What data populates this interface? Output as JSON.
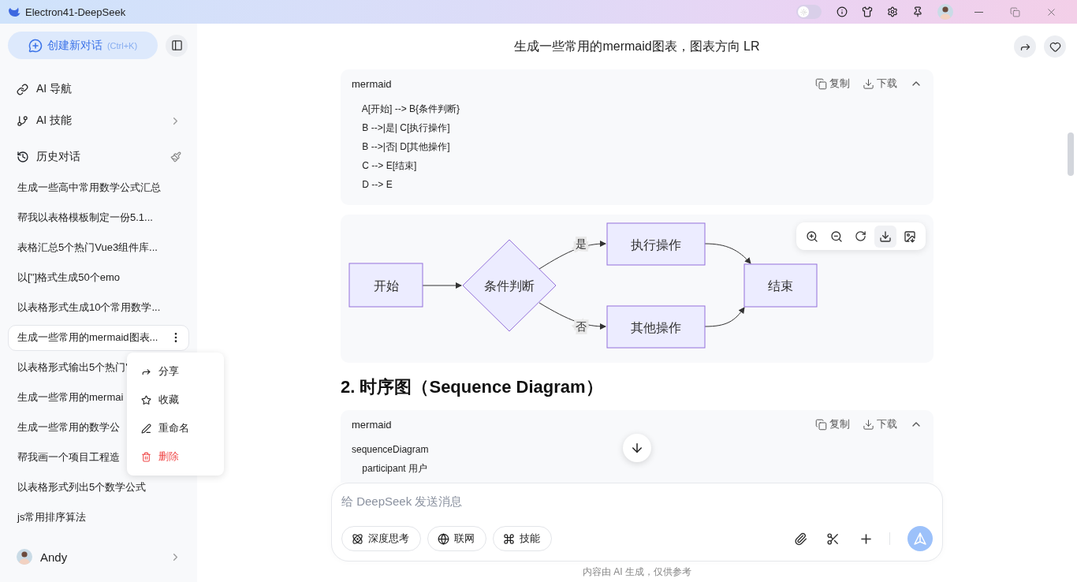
{
  "window": {
    "title": "Electron41-DeepSeek",
    "theme_toggle": {
      "on": false
    }
  },
  "sidebar": {
    "new_chat": {
      "label": "创建新对话",
      "shortcut": "(Ctrl+K)"
    },
    "nav": [
      {
        "label": "AI 导航",
        "kind": "link",
        "expandable": false
      },
      {
        "label": "AI 技能",
        "kind": "branch",
        "expandable": true
      }
    ],
    "history": {
      "title": "历史对话",
      "items": [
        {
          "title": "生成一些高中常用数学公式汇总",
          "selected": false
        },
        {
          "title": "帮我以表格模板制定一份5.1...",
          "selected": false
        },
        {
          "title": "表格汇总5个热门Vue3组件库...",
          "selected": false
        },
        {
          "title": "以['']格式生成50个emo",
          "selected": false
        },
        {
          "title": "以表格形式生成10个常用数学...",
          "selected": false
        },
        {
          "title": "生成一些常用的mermaid图表...",
          "selected": true
        },
        {
          "title": "以表格形式输出5个热门'",
          "selected": false
        },
        {
          "title": "生成一些常用的mermai",
          "selected": false
        },
        {
          "title": "生成一些常用的数学公",
          "selected": false
        },
        {
          "title": "帮我画一个项目工程造",
          "selected": false
        },
        {
          "title": "以表格形式列出5个数学公式",
          "selected": false
        },
        {
          "title": "js常用排序算法",
          "selected": false
        }
      ],
      "menu": {
        "items": [
          {
            "label": "分享",
            "kind": "share",
            "danger": false
          },
          {
            "label": "收藏",
            "kind": "star",
            "danger": false
          },
          {
            "label": "重命名",
            "kind": "rename",
            "danger": false
          },
          {
            "label": "删除",
            "kind": "delete",
            "danger": true
          }
        ]
      }
    },
    "user": {
      "name": "Andy"
    }
  },
  "chat": {
    "title": "生成一些常用的mermaid图表，图表方向 LR",
    "blocks": [
      {
        "kind": "code",
        "language": "mermaid",
        "actions": [
          "复制",
          "下载"
        ],
        "lines": [
          "    A[开始] --> B{条件判断}",
          "    B -->|是| C[执行操作]",
          "    B -->|否| D[其他操作]",
          "    C --> E[结束]",
          "    D --> E"
        ]
      },
      {
        "kind": "flowchart",
        "nodes": [
          {
            "label": "开始",
            "kind": "process"
          },
          {
            "label": "条件判断",
            "kind": "decision"
          },
          {
            "label": "执行操作",
            "kind": "process"
          },
          {
            "label": "其他操作",
            "kind": "process"
          },
          {
            "label": "结束",
            "kind": "process"
          }
        ],
        "edge_labels": [
          "是",
          "否"
        ]
      },
      {
        "kind": "heading",
        "text": "2. 时序图（Sequence Diagram）"
      },
      {
        "kind": "code",
        "language": "mermaid",
        "actions": [
          "复制",
          "下载"
        ],
        "lines": [
          "sequenceDiagram",
          "    participant 用户"
        ]
      }
    ]
  },
  "composer": {
    "placeholder": "给 DeepSeek 发送消息",
    "tools": [
      {
        "label": "深度思考",
        "kind": "atom"
      },
      {
        "label": "联网",
        "kind": "globe"
      },
      {
        "label": "技能",
        "kind": "command"
      }
    ]
  },
  "disclaimer": "内容由 AI 生成，仅供参考"
}
